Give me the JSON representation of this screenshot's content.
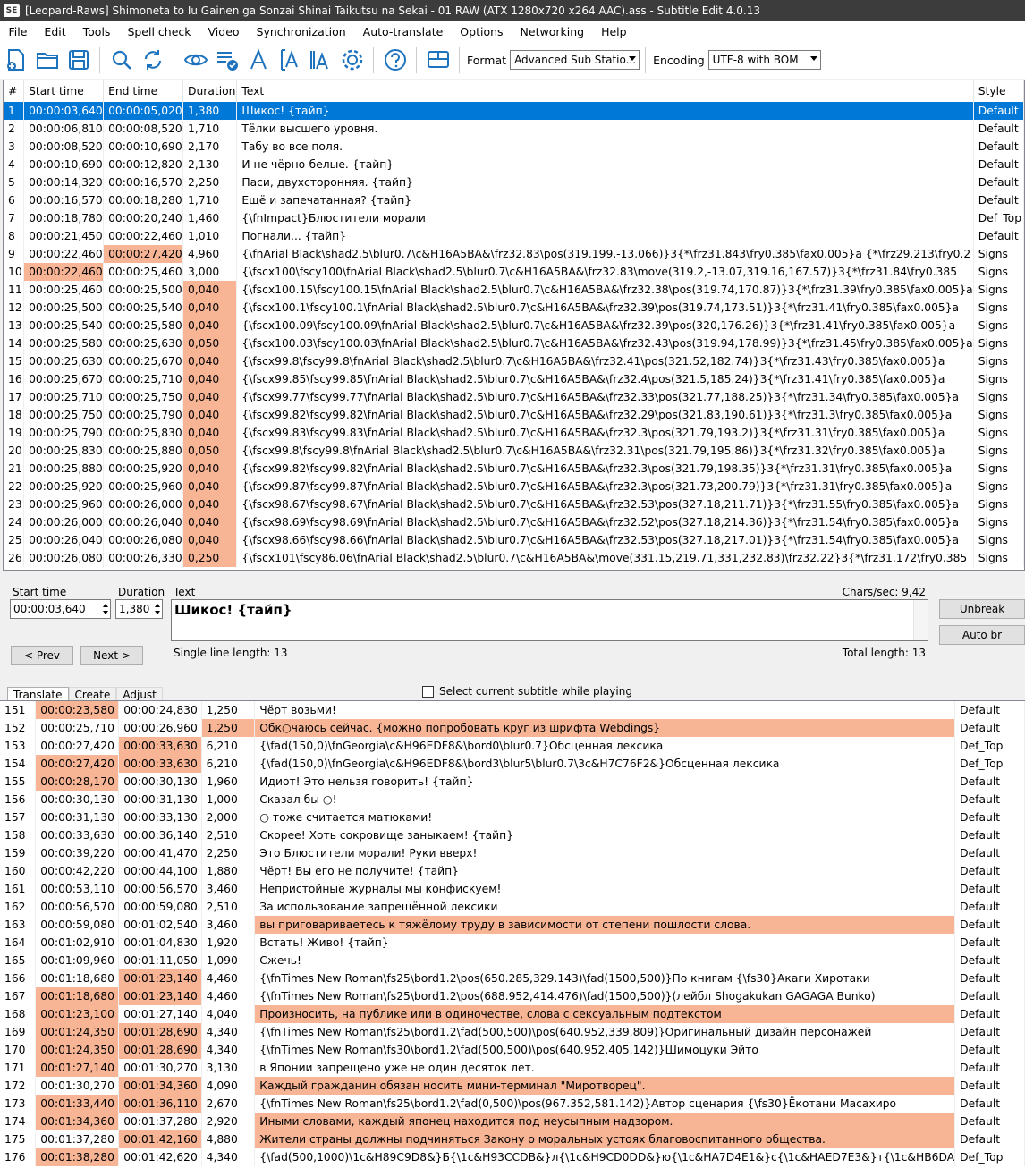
{
  "window": {
    "title": "[Leopard-Raws] Shimoneta to Iu Gainen ga Sonzai Shinai Taikutsu na Sekai - 01 RAW (ATX 1280x720 x264 AAC).ass - Subtitle Edit 4.0.13",
    "app_icon": "SE"
  },
  "menu": [
    "File",
    "Edit",
    "Tools",
    "Spell check",
    "Video",
    "Synchronization",
    "Auto-translate",
    "Options",
    "Networking",
    "Help"
  ],
  "toolbar": {
    "format_label": "Format",
    "format_value": "Advanced Sub Statio...",
    "encoding_label": "Encoding",
    "encoding_value": "UTF-8 with BOM",
    "icons": [
      "new-file-icon",
      "open-folder-icon",
      "save-icon",
      "find-icon",
      "replace-icon",
      "visual-sync-icon",
      "spell-check-icon",
      "font-icon",
      "text-fit-icon",
      "font-size-icon",
      "settings-gear-icon",
      "help-icon",
      "layout-icon"
    ]
  },
  "colors": {
    "selection": "#0078d7",
    "highlight": "#f8b595",
    "titlebar": "#3c3c3c"
  },
  "grid": {
    "headers": [
      "#",
      "Start time",
      "End time",
      "Duration",
      "Text",
      "Style"
    ],
    "rows": [
      {
        "n": "1",
        "s": "00:00:03,640",
        "e": "00:00:05,020",
        "d": "1,380",
        "t": "Шикос! {тайп}",
        "st": "Default",
        "sel": true
      },
      {
        "n": "2",
        "s": "00:00:06,810",
        "e": "00:00:08,520",
        "d": "1,710",
        "t": "Тёлки высшего уровня.",
        "st": "Default"
      },
      {
        "n": "3",
        "s": "00:00:08,520",
        "e": "00:00:10,690",
        "d": "2,170",
        "t": "Табу во все поля.",
        "st": "Default"
      },
      {
        "n": "4",
        "s": "00:00:10,690",
        "e": "00:00:12,820",
        "d": "2,130",
        "t": "И не чёрно-белые. {тайп}",
        "st": "Default"
      },
      {
        "n": "5",
        "s": "00:00:14,320",
        "e": "00:00:16,570",
        "d": "2,250",
        "t": "Паси, двухсторонняя. {тайп}",
        "st": "Default"
      },
      {
        "n": "6",
        "s": "00:00:16,570",
        "e": "00:00:18,280",
        "d": "1,710",
        "t": "Ещё и запечатанная? {тайп}",
        "st": "Default"
      },
      {
        "n": "7",
        "s": "00:00:18,780",
        "e": "00:00:20,240",
        "d": "1,460",
        "t": "{\\fnImpact}Блюстители морали",
        "st": "Def_Top"
      },
      {
        "n": "8",
        "s": "00:00:21,450",
        "e": "00:00:22,460",
        "d": "1,010",
        "t": "Погнали... {тайп}",
        "st": "Default"
      },
      {
        "n": "9",
        "s": "00:00:22,460",
        "e": "00:00:27,420",
        "d": "4,960",
        "t": "{\\fnArial Black\\shad2.5\\blur0.7\\c&H16A5BA&\\frz32.83\\pos(319.199,-13.066)}3{*\\frz31.843\\fry0.385\\fax0.005}а {*\\frz29.213\\fry0.2",
        "st": "Signs",
        "he": true
      },
      {
        "n": "10",
        "s": "00:00:22,460",
        "e": "00:00:25,460",
        "d": "3,000",
        "t": "{\\fscx100\\fscy100\\fnArial Black\\shad2.5\\blur0.7\\c&H16A5BA&\\frz32.83\\move(319.2,-13.07,319.16,167.57)}3{*\\frz31.84\\fry0.385",
        "st": "Signs",
        "hs": true
      },
      {
        "n": "11",
        "s": "00:00:25,460",
        "e": "00:00:25,500",
        "d": "0,040",
        "t": "{\\fscx100.15\\fscy100.15\\fnArial Black\\shad2.5\\blur0.7\\c&H16A5BA&\\frz32.38\\pos(319.74,170.87)}3{*\\frz31.39\\fry0.385\\fax0.005}а",
        "st": "Signs",
        "hd": true
      },
      {
        "n": "12",
        "s": "00:00:25,500",
        "e": "00:00:25,540",
        "d": "0,040",
        "t": "{\\fscx100.1\\fscy100.1\\fnArial Black\\shad2.5\\blur0.7\\c&H16A5BA&\\frz32.39\\pos(319.74,173.51)}3{*\\frz31.41\\fry0.385\\fax0.005}а",
        "st": "Signs",
        "hd": true
      },
      {
        "n": "13",
        "s": "00:00:25,540",
        "e": "00:00:25,580",
        "d": "0,040",
        "t": "{\\fscx100.09\\fscy100.09\\fnArial Black\\shad2.5\\blur0.7\\c&H16A5BA&\\frz32.39\\pos(320,176.26)}3{*\\frz31.41\\fry0.385\\fax0.005}а",
        "st": "Signs",
        "hd": true
      },
      {
        "n": "14",
        "s": "00:00:25,580",
        "e": "00:00:25,630",
        "d": "0,050",
        "t": "{\\fscx100.03\\fscy100.03\\fnArial Black\\shad2.5\\blur0.7\\c&H16A5BA&\\frz32.43\\pos(319.94,178.99)}3{*\\frz31.45\\fry0.385\\fax0.005}а",
        "st": "Signs",
        "hd": true
      },
      {
        "n": "15",
        "s": "00:00:25,630",
        "e": "00:00:25,670",
        "d": "0,040",
        "t": "{\\fscx99.8\\fscy99.8\\fnArial Black\\shad2.5\\blur0.7\\c&H16A5BA&\\frz32.41\\pos(321.52,182.74)}3{*\\frz31.43\\fry0.385\\fax0.005}а",
        "st": "Signs",
        "hd": true
      },
      {
        "n": "16",
        "s": "00:00:25,670",
        "e": "00:00:25,710",
        "d": "0,040",
        "t": "{\\fscx99.85\\fscy99.85\\fnArial Black\\shad2.5\\blur0.7\\c&H16A5BA&\\frz32.4\\pos(321.5,185.24)}3{*\\frz31.41\\fry0.385\\fax0.005}а",
        "st": "Signs",
        "hd": true
      },
      {
        "n": "17",
        "s": "00:00:25,710",
        "e": "00:00:25,750",
        "d": "0,040",
        "t": "{\\fscx99.77\\fscy99.77\\fnArial Black\\shad2.5\\blur0.7\\c&H16A5BA&\\frz32.33\\pos(321.77,188.25)}3{*\\frz31.34\\fry0.385\\fax0.005}а",
        "st": "Signs",
        "hd": true
      },
      {
        "n": "18",
        "s": "00:00:25,750",
        "e": "00:00:25,790",
        "d": "0,040",
        "t": "{\\fscx99.82\\fscy99.82\\fnArial Black\\shad2.5\\blur0.7\\c&H16A5BA&\\frz32.29\\pos(321.83,190.61)}3{*\\frz31.3\\fry0.385\\fax0.005}а",
        "st": "Signs",
        "hd": true
      },
      {
        "n": "19",
        "s": "00:00:25,790",
        "e": "00:00:25,830",
        "d": "0,040",
        "t": "{\\fscx99.83\\fscy99.83\\fnArial Black\\shad2.5\\blur0.7\\c&H16A5BA&\\frz32.3\\pos(321.79,193.2)}3{*\\frz31.31\\fry0.385\\fax0.005}а",
        "st": "Signs",
        "hd": true
      },
      {
        "n": "20",
        "s": "00:00:25,830",
        "e": "00:00:25,880",
        "d": "0,050",
        "t": "{\\fscx99.8\\fscy99.8\\fnArial Black\\shad2.5\\blur0.7\\c&H16A5BA&\\frz32.31\\pos(321.79,195.86)}3{*\\frz31.32\\fry0.385\\fax0.005}а",
        "st": "Signs",
        "hd": true
      },
      {
        "n": "21",
        "s": "00:00:25,880",
        "e": "00:00:25,920",
        "d": "0,040",
        "t": "{\\fscx99.82\\fscy99.82\\fnArial Black\\shad2.5\\blur0.7\\c&H16A5BA&\\frz32.3\\pos(321.79,198.35)}3{*\\frz31.31\\fry0.385\\fax0.005}а",
        "st": "Signs",
        "hd": true
      },
      {
        "n": "22",
        "s": "00:00:25,920",
        "e": "00:00:25,960",
        "d": "0,040",
        "t": "{\\fscx99.87\\fscy99.87\\fnArial Black\\shad2.5\\blur0.7\\c&H16A5BA&\\frz32.3\\pos(321.73,200.79)}3{*\\frz31.31\\fry0.385\\fax0.005}а",
        "st": "Signs",
        "hd": true
      },
      {
        "n": "23",
        "s": "00:00:25,960",
        "e": "00:00:26,000",
        "d": "0,040",
        "t": "{\\fscx98.67\\fscy98.67\\fnArial Black\\shad2.5\\blur0.7\\c&H16A5BA&\\frz32.53\\pos(327.18,211.71)}3{*\\frz31.55\\fry0.385\\fax0.005}а",
        "st": "Signs",
        "hd": true
      },
      {
        "n": "24",
        "s": "00:00:26,000",
        "e": "00:00:26,040",
        "d": "0,040",
        "t": "{\\fscx98.69\\fscy98.69\\fnArial Black\\shad2.5\\blur0.7\\c&H16A5BA&\\frz32.52\\pos(327.18,214.36)}3{*\\frz31.54\\fry0.385\\fax0.005}а",
        "st": "Signs",
        "hd": true
      },
      {
        "n": "25",
        "s": "00:00:26,040",
        "e": "00:00:26,080",
        "d": "0,040",
        "t": "{\\fscx98.66\\fscy98.66\\fnArial Black\\shad2.5\\blur0.7\\c&H16A5BA&\\frz32.53\\pos(327.18,217.01)}3{*\\frz31.54\\fry0.385\\fax0.005}а",
        "st": "Signs",
        "hd": true
      },
      {
        "n": "26",
        "s": "00:00:26,080",
        "e": "00:00:26,330",
        "d": "0,250",
        "t": "{\\fscx101\\fscy86.06\\fnArial Black\\shad2.5\\blur0.7\\c&H16A5BA&\\move(331.15,219.71,331,232.83)\\frz32.22}3{*\\frz31.172\\fry0.385",
        "st": "Signs",
        "hd": true
      }
    ]
  },
  "editor": {
    "start_label": "Start time",
    "start_value": "00:00:03,640",
    "duration_label": "Duration",
    "duration_value": "1,380",
    "text_label": "Text",
    "chars_sec": "Chars/sec: 9,42",
    "text_value": "Шикос! {тайп}",
    "single_line": "Single line length: 13",
    "total_length": "Total length: 13",
    "prev": "< Prev",
    "next": "Next >",
    "unbreak": "Unbreak",
    "autobr": "Auto br"
  },
  "tabs": [
    "Translate",
    "Create",
    "Adjust"
  ],
  "select_current_label": "Select current subtitle while playing",
  "lower": {
    "rows": [
      {
        "n": "151",
        "s": "00:00:23,580",
        "e": "00:00:24,830",
        "d": "1,250",
        "t": "Чёрт возьми!",
        "st": "Default",
        "hs": true
      },
      {
        "n": "152",
        "s": "00:00:25,710",
        "e": "00:00:26,960",
        "d": "1,250",
        "t": "Обк○чаюсь сейчас. {можно попробовать круг из шрифта Webdings}",
        "st": "Default",
        "hd": true,
        "ht": true
      },
      {
        "n": "153",
        "s": "00:00:27,420",
        "e": "00:00:33,630",
        "d": "6,210",
        "t": "{\\fad(150,0)\\fnGeorgia\\c&H96EDF8&\\bord0\\blur0.7}Обсценная лексика",
        "st": "Def_Top",
        "he": true
      },
      {
        "n": "154",
        "s": "00:00:27,420",
        "e": "00:00:33,630",
        "d": "6,210",
        "t": "{\\fad(150,0)\\fnGeorgia\\c&H96EDF8&\\bord3\\blur5\\blur0.7\\3c&H7C76F2&}Обсценная лексика",
        "st": "Def_Top",
        "hs": true,
        "he": true
      },
      {
        "n": "155",
        "s": "00:00:28,170",
        "e": "00:00:30,130",
        "d": "1,960",
        "t": "Идиот! Это нельзя говорить! {тайп}",
        "st": "Default",
        "hs": true
      },
      {
        "n": "156",
        "s": "00:00:30,130",
        "e": "00:00:31,130",
        "d": "1,000",
        "t": "Сказал бы ○!",
        "st": "Default"
      },
      {
        "n": "157",
        "s": "00:00:31,130",
        "e": "00:00:33,130",
        "d": "2,000",
        "t": "○ тоже считается матюками!",
        "st": "Default"
      },
      {
        "n": "158",
        "s": "00:00:33,630",
        "e": "00:00:36,140",
        "d": "2,510",
        "t": "Скорее! Хоть сокровище заныкаем! {тайп}",
        "st": "Default"
      },
      {
        "n": "159",
        "s": "00:00:39,220",
        "e": "00:00:41,470",
        "d": "2,250",
        "t": "Это Блюстители морали! Руки вверх!",
        "st": "Default"
      },
      {
        "n": "160",
        "s": "00:00:42,220",
        "e": "00:00:44,100",
        "d": "1,880",
        "t": "Чёрт! Вы его не получите! {тайп}",
        "st": "Default"
      },
      {
        "n": "161",
        "s": "00:00:53,110",
        "e": "00:00:56,570",
        "d": "3,460",
        "t": "Непристойные журналы мы конфискуем!",
        "st": "Default"
      },
      {
        "n": "162",
        "s": "00:00:56,570",
        "e": "00:00:59,080",
        "d": "2,510",
        "t": "За использование запрещённой лексики",
        "st": "Default"
      },
      {
        "n": "163",
        "s": "00:00:59,080",
        "e": "00:01:02,540",
        "d": "3,460",
        "t": "вы приговариваетесь к тяжёлому труду в зависимости от степени пошлости слова.",
        "st": "Default",
        "ht": true
      },
      {
        "n": "164",
        "s": "00:01:02,910",
        "e": "00:01:04,830",
        "d": "1,920",
        "t": "Встать! Живо! {тайп}",
        "st": "Default"
      },
      {
        "n": "165",
        "s": "00:01:09,960",
        "e": "00:01:11,050",
        "d": "1,090",
        "t": "Сжечь!",
        "st": "Default"
      },
      {
        "n": "166",
        "s": "00:01:18,680",
        "e": "00:01:23,140",
        "d": "4,460",
        "t": "{\\fnTimes New Roman\\fs25\\bord1.2\\pos(650.285,329.143)\\fad(1500,500)}По книгам     {\\fs30}Акаги Хиротаки",
        "st": "Default",
        "he": true
      },
      {
        "n": "167",
        "s": "00:01:18,680",
        "e": "00:01:23,140",
        "d": "4,460",
        "t": "{\\fnTimes New Roman\\fs25\\bord1.2\\pos(688.952,414.476)\\fad(1500,500)}(лейбл Shogakukan GAGAGA Bunko)",
        "st": "Default",
        "hs": true,
        "he": true
      },
      {
        "n": "168",
        "s": "00:01:23,100",
        "e": "00:01:27,140",
        "d": "4,040",
        "t": "Произносить, на публике или в одиночестве, слова с сексуальным подтекстом",
        "st": "Default",
        "hs": true,
        "ht": true
      },
      {
        "n": "169",
        "s": "00:01:24,350",
        "e": "00:01:28,690",
        "d": "4,340",
        "t": "{\\fnTimes New Roman\\fs25\\bord1.2\\fad(500,500)\\pos(640.952,339.809)}Оригинальный дизайн персонажей",
        "st": "Default",
        "hs": true,
        "he": true
      },
      {
        "n": "170",
        "s": "00:01:24,350",
        "e": "00:01:28,690",
        "d": "4,340",
        "t": "{\\fnTimes New Roman\\fs30\\bord1.2\\fad(500,500)\\pos(640.952,405.142)}Шимоцуки Эйто",
        "st": "Default",
        "hs": true,
        "he": true
      },
      {
        "n": "171",
        "s": "00:01:27,140",
        "e": "00:01:30,270",
        "d": "3,130",
        "t": "в Японии запрещено уже не один десяток лет.",
        "st": "Default",
        "hs": true
      },
      {
        "n": "172",
        "s": "00:01:30,270",
        "e": "00:01:34,360",
        "d": "4,090",
        "t": "Каждый гражданин обязан носить мини-терминал \"Миротворец\".",
        "st": "Default",
        "he": true,
        "ht": true
      },
      {
        "n": "173",
        "s": "00:01:33,440",
        "e": "00:01:36,110",
        "d": "2,670",
        "t": "{\\fnTimes New Roman\\fs25\\bord1.2\\fad(0,500)\\pos(967.352,581.142)}Автор сценария  {\\fs30}Ёкотани Масахиро",
        "st": "Default",
        "hs": true,
        "he": true
      },
      {
        "n": "174",
        "s": "00:01:34,360",
        "e": "00:01:37,280",
        "d": "2,920",
        "t": "Иными словами, каждый японец находится под неусыпным надзором.",
        "st": "Default",
        "hs": true,
        "ht": true
      },
      {
        "n": "175",
        "s": "00:01:37,280",
        "e": "00:01:42,160",
        "d": "4,880",
        "t": "Жители страны должны подчиняться Закону о моральных устоях благовоспитанного общества.",
        "st": "Default",
        "he": true,
        "ht": true
      },
      {
        "n": "176",
        "s": "00:01:38,280",
        "e": "00:01:42,620",
        "d": "4,340",
        "t": "{\\fad(500,1000)\\1c&H89C9D8&}Б{\\1c&H93CCDB&}л{\\1c&H9CD0DD&}ю{\\1c&HA7D4E1&}с{\\1c&HAED7E3&}т{\\1c&HB6DA",
        "st": "Def_Top",
        "hs": true
      }
    ]
  }
}
